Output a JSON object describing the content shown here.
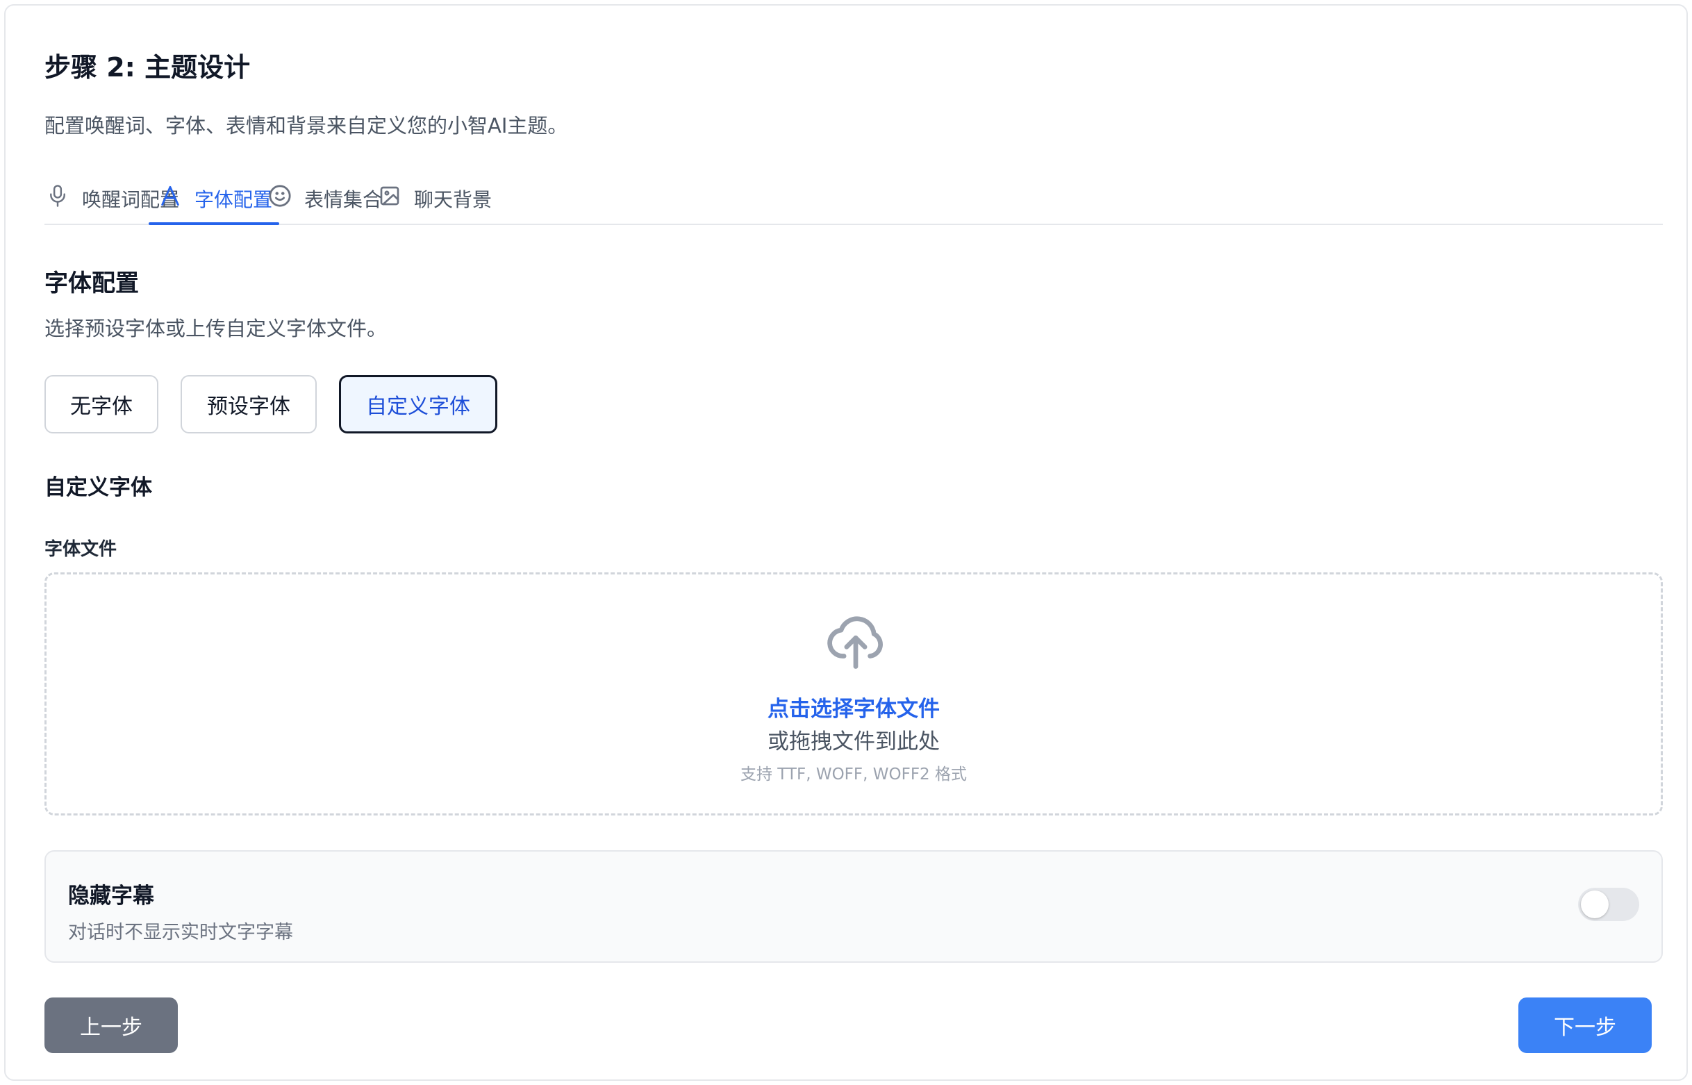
{
  "page": {
    "title": "步骤 2: 主题设计",
    "subtitle": "配置唤醒词、字体、表情和背景来自定义您的小智AI主题。"
  },
  "tabs": [
    {
      "label": "唤醒词配置",
      "icon": "microphone-icon",
      "active": false
    },
    {
      "label": "字体配置",
      "icon": "font-icon",
      "active": true
    },
    {
      "label": "表情集合",
      "icon": "smiley-icon",
      "active": false
    },
    {
      "label": "聊天背景",
      "icon": "image-icon",
      "active": false
    }
  ],
  "font_section": {
    "title": "字体配置",
    "description": "选择预设字体或上传自定义字体文件。",
    "options": [
      {
        "label": "无字体",
        "selected": false
      },
      {
        "label": "预设字体",
        "selected": false
      },
      {
        "label": "自定义字体",
        "selected": true
      }
    ],
    "custom_title": "自定义字体",
    "file_label": "字体文件"
  },
  "upload": {
    "icon": "cloud-upload-icon",
    "primary": "点击选择字体文件",
    "secondary": "或拖拽文件到此处",
    "hint": "支持 TTF, WOFF, WOFF2 格式"
  },
  "subtitle_setting": {
    "title": "隐藏字幕",
    "description": "对话时不显示实时文字字幕",
    "enabled": false
  },
  "nav": {
    "prev_label": "上一步",
    "next_label": "下一步"
  },
  "colors": {
    "accent": "#2563eb",
    "next_button": "#3b82f6",
    "prev_button": "#6b7280",
    "selected_bg": "#eff6ff"
  }
}
